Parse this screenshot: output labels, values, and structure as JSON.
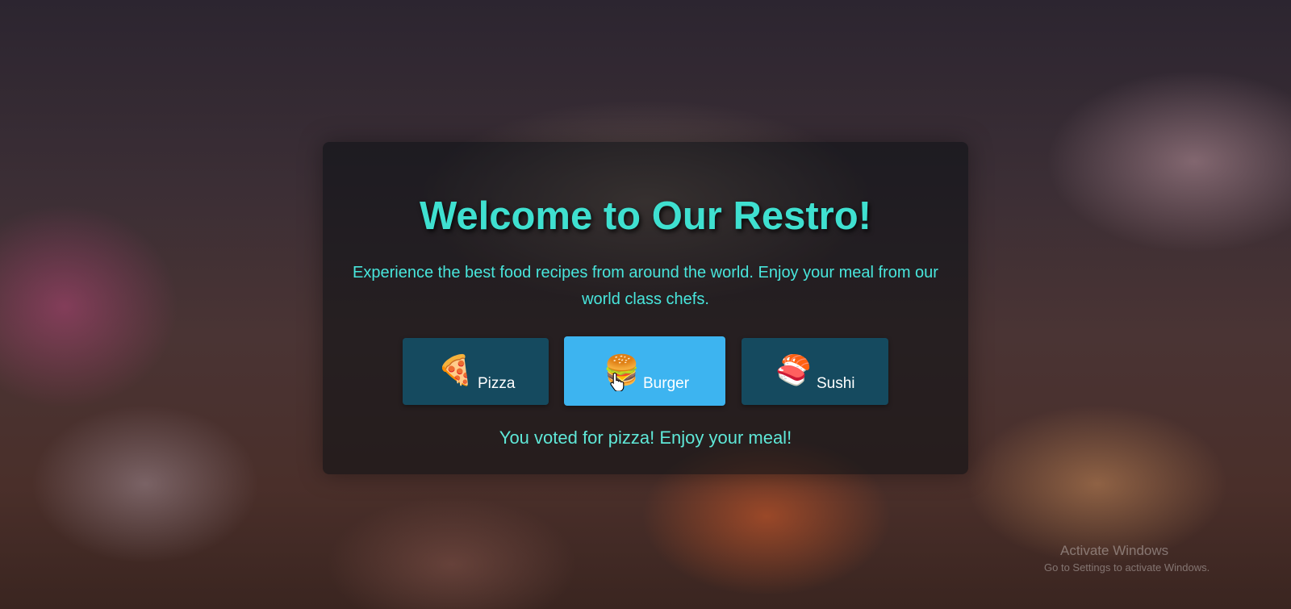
{
  "hero": {
    "title": "Welcome to Our Restro!",
    "subtitle": "Experience the best food recipes from around the world. Enjoy your meal from our world class chefs."
  },
  "vote_buttons": [
    {
      "label": "Pizza",
      "icon": "pizza-icon",
      "emoji": "🍕",
      "state": "default"
    },
    {
      "label": "Burger",
      "icon": "burger-icon",
      "emoji": "🍔",
      "state": "hover"
    },
    {
      "label": "Sushi",
      "icon": "sushi-icon",
      "emoji": "🍣",
      "state": "default"
    }
  ],
  "vote_message": "You voted for pizza! Enjoy your meal!",
  "watermark": {
    "title": "Activate Windows",
    "subtitle": "Go to Settings to activate Windows."
  },
  "colors": {
    "accent": "#3fe0d0",
    "button": "#154a5f",
    "button_active": "#3db4f0"
  }
}
